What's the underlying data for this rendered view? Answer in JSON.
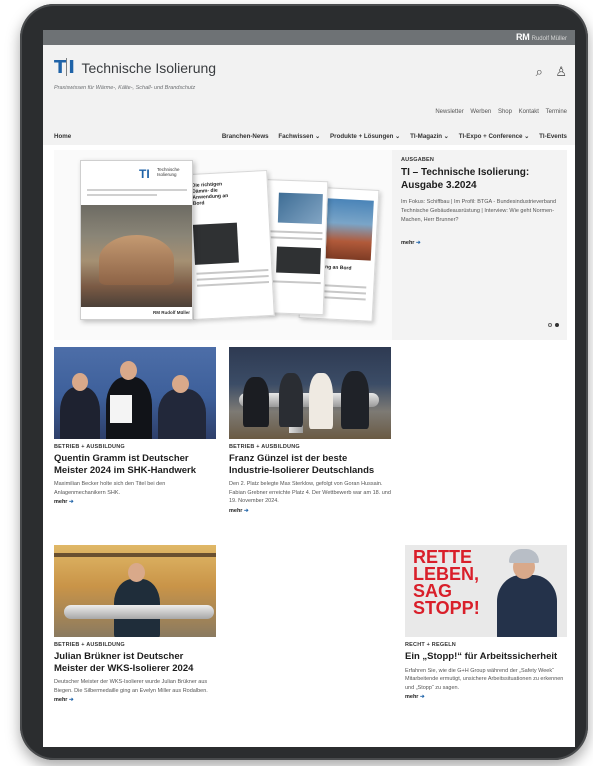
{
  "publisher": {
    "logo": "RM",
    "name": "Rudolf Müller"
  },
  "brand": {
    "mark": "TI",
    "name": "Technische Isolierung",
    "tagline": "Praxiswissen für Wärme-, Kälte-, Schall- und Brandschutz",
    "accent": "#1f63a8"
  },
  "header_icons": {
    "search": "search-icon",
    "user": "user-icon"
  },
  "service_nav": [
    "Newsletter",
    "Werben",
    "Shop",
    "Kontakt",
    "Termine"
  ],
  "main_nav": {
    "home": "Home",
    "items": [
      "Branchen-News",
      "Fachwissen ⌄",
      "Produkte + Lösungen ⌄",
      "TI-Magazin ⌄",
      "TI-Expo + Conference ⌄",
      "TI-Events"
    ]
  },
  "hero": {
    "kicker": "AUSGABEN",
    "title": "TI – Technische Isolierung: Ausgabe 3.2024",
    "description": "Im Fokus: Schiffbau | Im Profil: BTGA - Bundesindustrieverband Technische Gebäudeausrüstung | Interview: Wie geht Normen-Machen, Herr Brunner?",
    "more": "mehr",
    "cover_logo": "TI",
    "cover_title": "Technische Isolierung",
    "cover_publisher": "RM Rudolf Müller",
    "page2_title": "Die richtigen Dämm- die Anwendung an Bord",
    "page4_title": "dämmung an Bord",
    "slider_dots": 2,
    "slider_active": 2
  },
  "articles": [
    {
      "kicker": "BETRIEB + AUSBILDUNG",
      "title": "Quentin Gramm ist Deutscher Meister 2024 im SHK-Handwerk",
      "description": "Maximilian Becker holte sich den Titel bei den Anlagenmechanikern SHK.",
      "more": "mehr"
    },
    {
      "kicker": "BETRIEB + AUSBILDUNG",
      "title": "Franz Günzel ist der beste Industrie-Isolierer Deutschlands",
      "description": "Den 2. Platz belegte Max Sterklow, gefolgt von Goran Hussain. Fabian Grebner erreichte Platz 4. Der Wettbewerb war am 18. und 19. November 2024.",
      "more": "mehr"
    },
    {
      "kicker": "BETRIEB + AUSBILDUNG",
      "title": "Julian Brükner ist Deutscher Meister der WKS-Isolierer 2024",
      "description": "Deutscher Meister der WKS-Isolierer wurde Julian Brükner aus Biegen. Die Silbermedaille ging an Evelyn Miller aus Rodalben.",
      "more": "mehr"
    },
    {
      "kicker": "RECHT + REGELN",
      "title": "Ein „Stopp!“ für Arbeitssicherheit",
      "description": "Erfahren Sie, wie die G+H Group während der „Safety Week“ Mitarbeitende ermutigt, unsichere Arbeitssituationen zu erkennen und „Stopp“ zu sagen.",
      "more": "mehr",
      "image_text": "RETTE LEBEN, SAG STOPP!"
    }
  ]
}
